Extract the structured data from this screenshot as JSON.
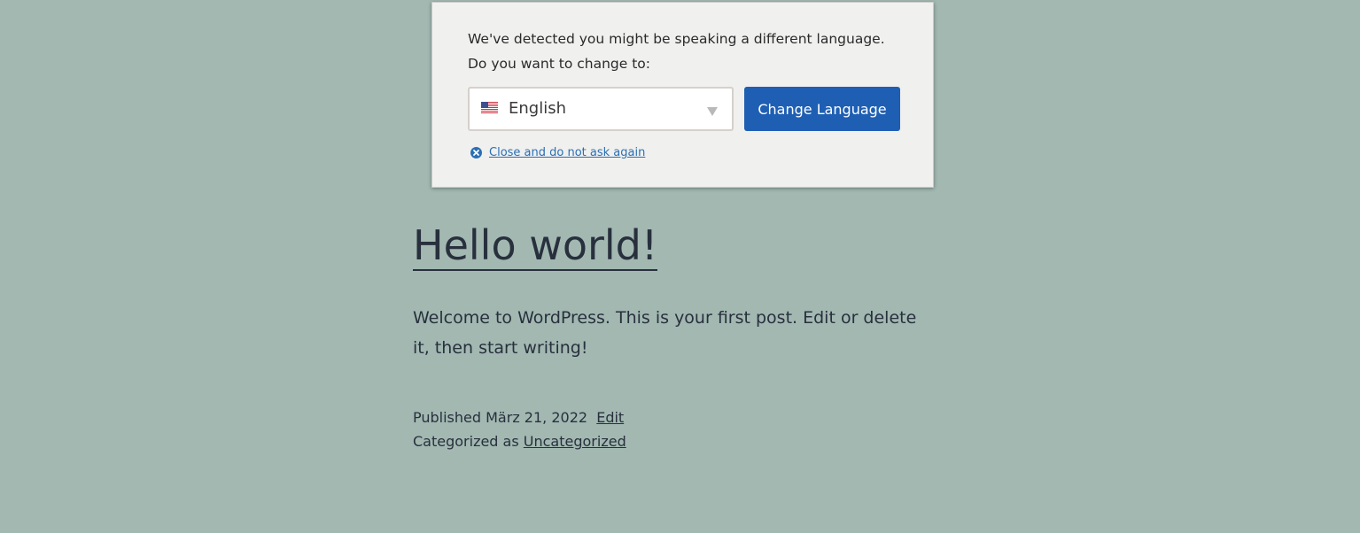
{
  "language_prompt": {
    "message_line1": "We've detected you might be speaking a different language.",
    "message_line2": "Do you want to change to:",
    "selected_language": "English",
    "flag_icon": "us-flag-icon",
    "change_button_label": "Change Language",
    "close_link_label": "Close and do not ask again",
    "accent_color": "#1e5fb4"
  },
  "post": {
    "title": "Hello world!",
    "body": "Welcome to WordPress. This is your first post. Edit or delete it, then start writing!",
    "published_label": "Published",
    "published_date": "März 21, 2022",
    "edit_label": "Edit",
    "categorized_label": "Categorized as",
    "category": "Uncategorized"
  },
  "background_color": "#a2b8b1"
}
